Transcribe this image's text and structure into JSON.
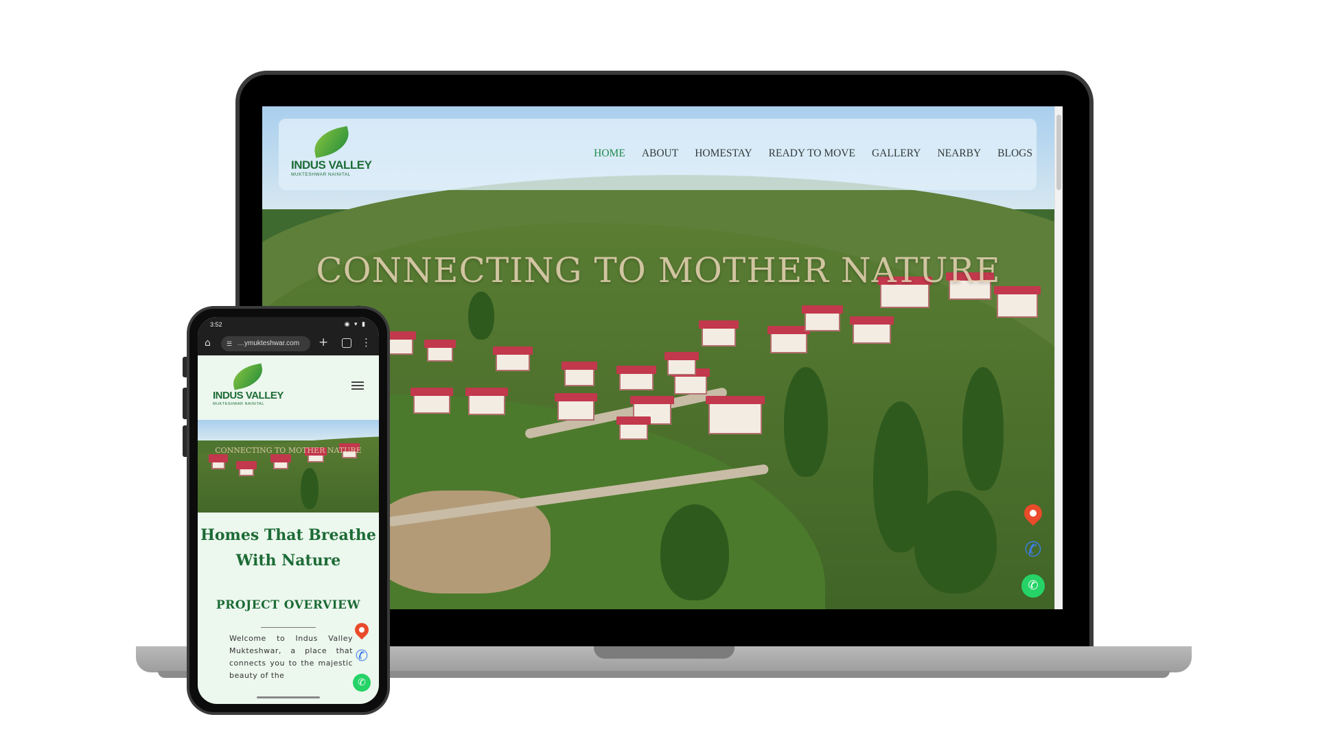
{
  "desktop": {
    "logo": {
      "title": "INDUS VALLEY",
      "subtitle": "MUKTESHWAR NAINITAL"
    },
    "nav": [
      {
        "label": "HOME"
      },
      {
        "label": "ABOUT"
      },
      {
        "label": "HOMESTAY"
      },
      {
        "label": "READY TO MOVE"
      },
      {
        "label": "GALLERY"
      },
      {
        "label": "NEARBY"
      },
      {
        "label": "BLOGS"
      }
    ],
    "active_nav": "HOME",
    "hero_title": "CONNECTING TO MOTHER NATURE",
    "floating_buttons": [
      "map-pin-icon",
      "phone-icon",
      "whatsapp-icon"
    ]
  },
  "mobile": {
    "status_time": "3:52",
    "url": "…ymukteshwar.com",
    "logo": {
      "title": "INDUS VALLEY",
      "subtitle": "MUKTESHWAR NAINITAL"
    },
    "hero_title": "CONNECTING TO MOTHER NATURE",
    "heading": "Homes That Breathe With Nature",
    "subheading": "PROJECT OVERVIEW",
    "body": "Welcome to Indus Valley Mukteshwar, a place that connects you to the majestic beauty of the"
  },
  "colors": {
    "brand_green": "#1c6b35",
    "nav_active": "#1e8a4b",
    "map_pin": "#e94b2b",
    "phone_icon": "#3f7ee8",
    "whatsapp": "#25d366"
  }
}
